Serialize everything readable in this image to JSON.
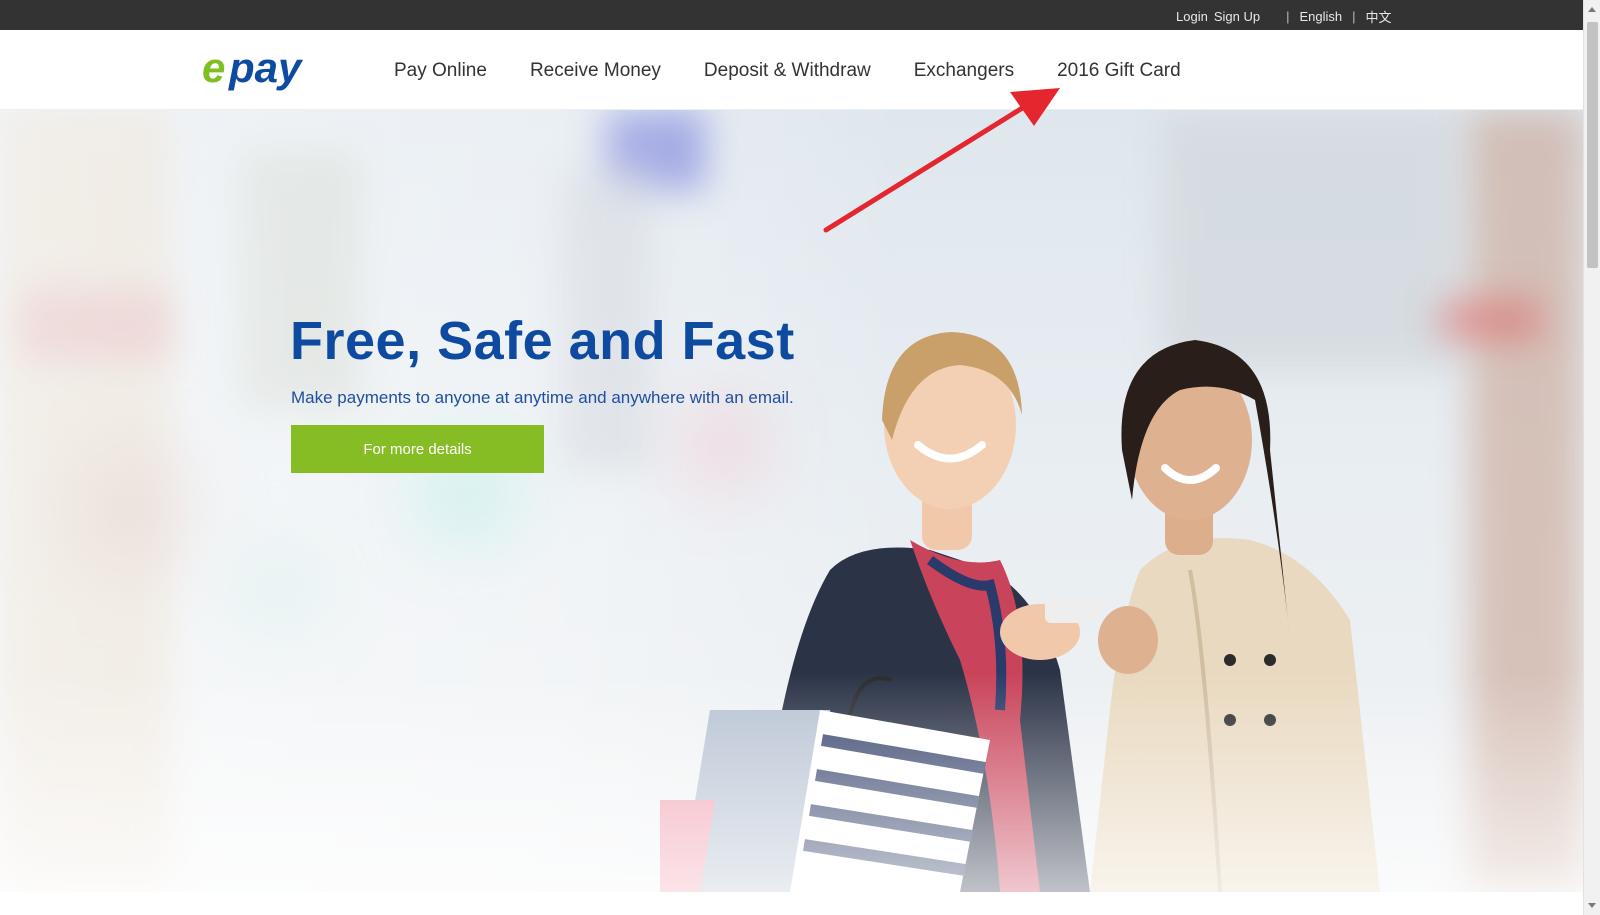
{
  "topbar": {
    "login": "Login",
    "signup": "Sign Up",
    "english": "English",
    "chinese": "中文",
    "separator": "|"
  },
  "header": {
    "logo_text": "epay",
    "logo_colors": {
      "e": "#7fbf22",
      "pay": "#0d4aa0"
    },
    "nav": [
      {
        "label": "Pay Online"
      },
      {
        "label": "Receive Money"
      },
      {
        "label": "Deposit & Withdraw"
      },
      {
        "label": "Exchangers"
      },
      {
        "label": "2016 Gift Card"
      }
    ]
  },
  "hero": {
    "title": "Free, Safe and Fast",
    "subtitle": "Make payments to anyone at anytime and anywhere with an email.",
    "cta_label": "For more details",
    "colors": {
      "title": "#0d4aa0",
      "cta": "#86bd24",
      "annotation": "#e6262e"
    }
  }
}
